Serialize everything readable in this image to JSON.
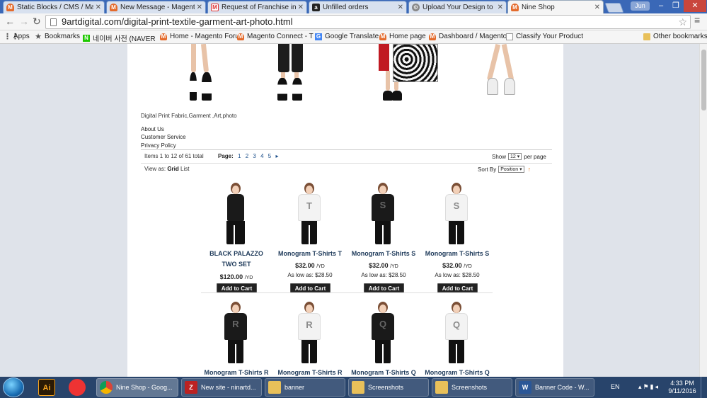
{
  "browser": {
    "tabs": [
      {
        "label": "Static Blocks / CMS / Mag",
        "icon": "magento-icon"
      },
      {
        "label": "New Message - Magento",
        "icon": "magento-icon"
      },
      {
        "label": "Request of Franchise info",
        "icon": "gmail-icon"
      },
      {
        "label": "Unfilled orders",
        "icon": "amazon-icon"
      },
      {
        "label": "Upload Your Design to Fa",
        "icon": "gear-icon"
      },
      {
        "label": "Nine Shop",
        "icon": "magento-icon",
        "active": true
      }
    ],
    "user": "Jun",
    "url": "9artdigital.com/digital-print-textile-garment-art-photo.html",
    "bookmarks": [
      {
        "label": "Apps",
        "icon": "apps-grid-icon"
      },
      {
        "label": "Bookmarks",
        "icon": "star-icon"
      },
      {
        "label": "네이버 사전 (NAVER",
        "icon": "naver-icon"
      },
      {
        "label": "Home - Magento Foru",
        "icon": "magento-icon"
      },
      {
        "label": "Magento Connect - T",
        "icon": "magento-icon"
      },
      {
        "label": "Google Translate",
        "icon": "google-translate-icon"
      },
      {
        "label": "Home page",
        "icon": "magento-icon"
      },
      {
        "label": "Dashboard / Magento",
        "icon": "magento-icon"
      },
      {
        "label": "Classify Your Product",
        "icon": "page-icon"
      },
      {
        "label": "Other bookmarks",
        "icon": "folder-icon"
      }
    ]
  },
  "page": {
    "category_description": "Digital Print Fabric,Garment ,Art,photo",
    "footer_links": [
      "About Us",
      "Customer Service",
      "Privacy Policy"
    ],
    "toolbar": {
      "amount": "Items 1 to 12 of 61 total",
      "page_label": "Page:",
      "pages": [
        "1",
        "2",
        "3",
        "4",
        "5",
        "▸"
      ],
      "show_label": "Show",
      "show_value": "12 ▾",
      "per_page": "per page",
      "view_as": "View as:",
      "grid": "Grid",
      "list": "List",
      "sort_label": "Sort By",
      "sort_value": "Position ▾",
      "sort_arrow": "↑"
    },
    "products": [
      {
        "name": "BLACK PALAZZO TWO SET",
        "price": "$120.00",
        "unit": "/YD",
        "as_low": "",
        "letter": "",
        "shirt": "black",
        "button": "Add to Cart"
      },
      {
        "name": "Monogram T-Shirts T",
        "price": "$32.00",
        "unit": "/YD",
        "as_low": "As low as: $28.50",
        "letter": "T",
        "shirt": "white",
        "button": "Add to Cart"
      },
      {
        "name": "Monogram T-Shirts S",
        "price": "$32.00",
        "unit": "/YD",
        "as_low": "As low as: $28.50",
        "letter": "S",
        "shirt": "black",
        "button": "Add to Cart"
      },
      {
        "name": "Monogram T-Shirts S",
        "price": "$32.00",
        "unit": "/YD",
        "as_low": "As low as: $28.50",
        "letter": "S",
        "shirt": "white",
        "button": "Add to Cart"
      },
      {
        "name": "Monogram T-Shirts R",
        "letter": "R",
        "shirt": "black"
      },
      {
        "name": "Monogram T-Shirts R",
        "letter": "R",
        "shirt": "white"
      },
      {
        "name": "Monogram T-Shirts Q",
        "letter": "Q",
        "shirt": "black"
      },
      {
        "name": "Monogram T-Shirts Q",
        "letter": "Q",
        "shirt": "white"
      }
    ]
  },
  "taskbar": {
    "items": [
      {
        "label": "Nine Shop - Goog...",
        "icon": "chrome-icon",
        "active": true
      },
      {
        "label": "New site - ninartd...",
        "icon": "filezilla-icon"
      },
      {
        "label": "banner",
        "icon": "folder-icon"
      },
      {
        "label": "Screenshots",
        "icon": "folder-icon"
      },
      {
        "label": "Screenshots",
        "icon": "folder-icon"
      },
      {
        "label": "Banner Code - W...",
        "icon": "word-icon"
      }
    ],
    "pinned": [
      {
        "label": "Ai",
        "icon": "illustrator-icon"
      },
      {
        "label": "",
        "icon": "app-icon"
      }
    ],
    "lang": "EN",
    "time": "4:33 PM",
    "date": "9/11/2016"
  }
}
